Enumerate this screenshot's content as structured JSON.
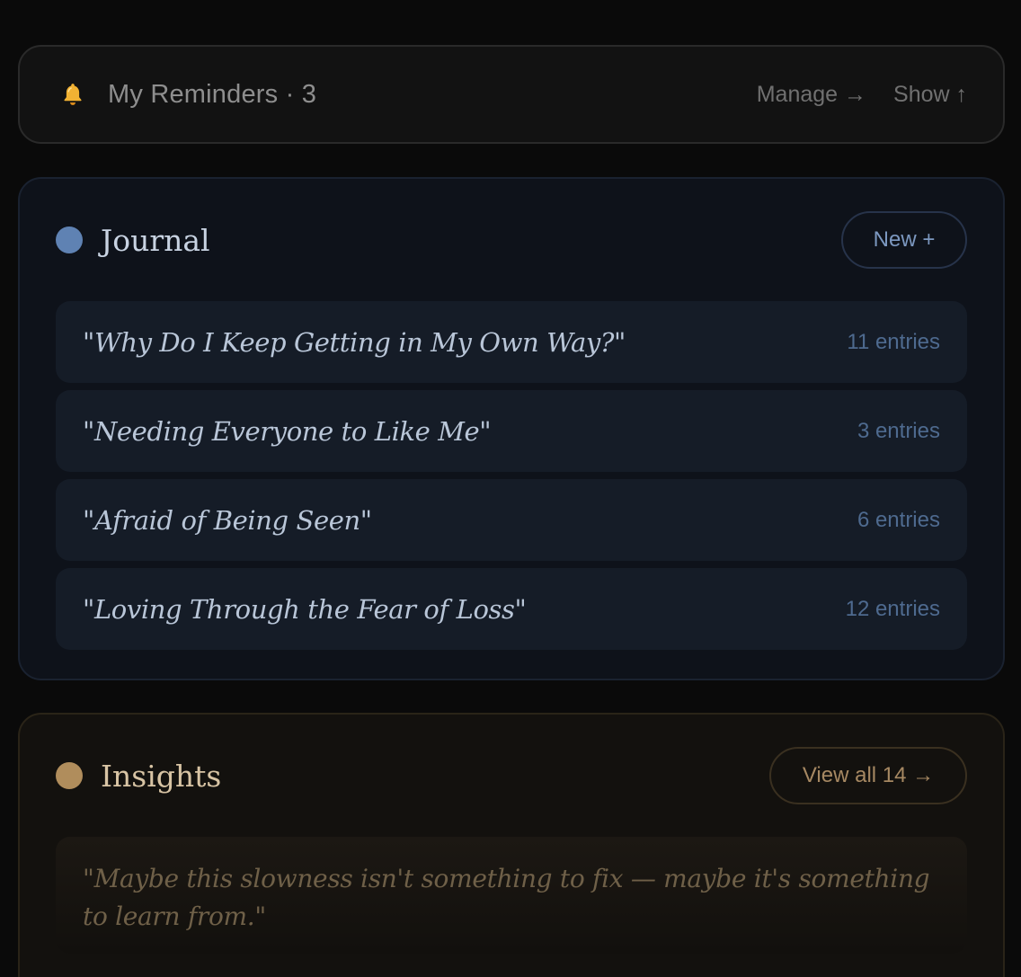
{
  "reminders": {
    "icon": "bell-icon",
    "title": "My Reminders · 3",
    "manage_label": "Manage →",
    "show_label": "Show ↑"
  },
  "journal": {
    "title": "Journal",
    "accent": "#5f82b3",
    "new_label": "New +",
    "entries": [
      {
        "title": "\"Why Do I Keep Getting in My Own Way?\"",
        "count": "11 entries"
      },
      {
        "title": "\"Needing Everyone to Like Me\"",
        "count": "3 entries"
      },
      {
        "title": "\"Afraid of Being Seen\"",
        "count": "6 entries"
      },
      {
        "title": "\"Loving Through the Fear of Loss\"",
        "count": "12 entries"
      }
    ]
  },
  "insights": {
    "title": "Insights",
    "accent": "#b08d5c",
    "view_all_label": "View all 14 →",
    "quote": "\"Maybe this slowness isn't something to fix — maybe it's something to learn from.\""
  }
}
